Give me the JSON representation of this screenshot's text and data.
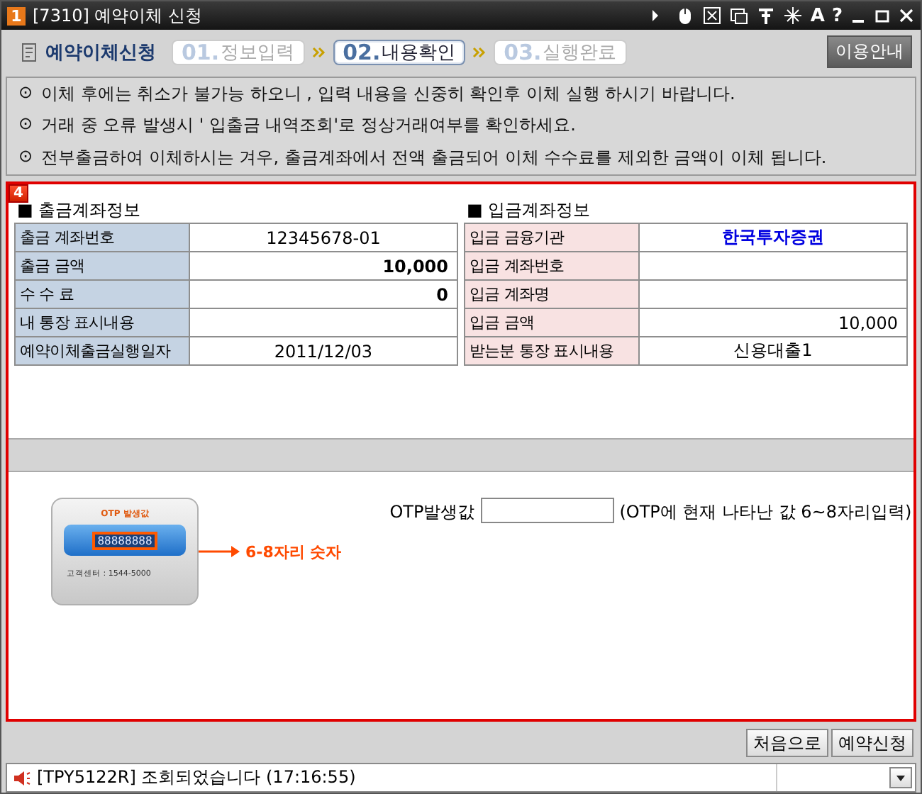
{
  "window": {
    "number": "1",
    "title": "[7310] 예약이체 신청",
    "toolbar_glyphs": [
      "A",
      "?"
    ]
  },
  "step_bar": {
    "title": "예약이체신청",
    "steps": [
      {
        "number": "01.",
        "label": "정보입력",
        "selected": false
      },
      {
        "number": "02.",
        "label": "내용확인",
        "selected": true
      },
      {
        "number": "03.",
        "label": "실행완료",
        "selected": false
      }
    ],
    "help_button": "이용안내"
  },
  "notices": [
    {
      "symbol": "⊙",
      "text": "이체 후에는 취소가 불가능 하오니 , 입력 내용을 신중히 확인후 이체 실행 하시기 바랍니다."
    },
    {
      "symbol": "⊙",
      "text": "거래 중 오류 발생시 ' 입출금 내역조회'로 정상거래여부를 확인하세요."
    },
    {
      "symbol": "⊙",
      "text": "전부출금하여 이체하시는 겨우, 출금계좌에서 전액 출금되어 이체 수수료를 제외한 금액이 이체 됩니다."
    }
  ],
  "panel": {
    "badge": "4",
    "withdrawal": {
      "heading": "■ 출금계좌정보",
      "rows": [
        {
          "label": "출금 계좌번호",
          "value": "12345678-01",
          "kind": "text"
        },
        {
          "label": "출금 금액",
          "value": "10,000",
          "kind": "amount_bold"
        },
        {
          "label": "수 수 료",
          "value": "0",
          "kind": "amount_bold"
        },
        {
          "label": "내 통장 표시내용",
          "kind": "text"
        },
        {
          "label": "예약이체출금실행일자",
          "value": "2011/12/03",
          "kind": "text"
        }
      ]
    },
    "deposit": {
      "heading": "■ 입금계좌정보",
      "rows": [
        {
          "label": "입금 금융기관",
          "value": "한국투자증권",
          "kind": "highlight"
        },
        {
          "label": "입금 계좌번호",
          "kind": "text"
        },
        {
          "label": "입금 계좌명",
          "kind": "text"
        },
        {
          "label": "입금 금액",
          "value": "10,000",
          "kind": "amount"
        },
        {
          "label": "받는분 통장 표시내용",
          "value": "신용대출1",
          "kind": "text"
        }
      ]
    },
    "otp": {
      "device_label": "OTP 발생값",
      "device_display": "88888888",
      "device_phone": "고객센터 : 1544-5000",
      "callout": "6-8자리 숫자",
      "field_label": "OTP발생값",
      "hint": "(OTP에 현재 나타난 값 6~8자리입력)"
    }
  },
  "buttons": [
    "처음으로",
    "예약신청"
  ],
  "status_bar": {
    "message": "[TPY5122R] 조회되었습니다 (17:16:55)"
  }
}
